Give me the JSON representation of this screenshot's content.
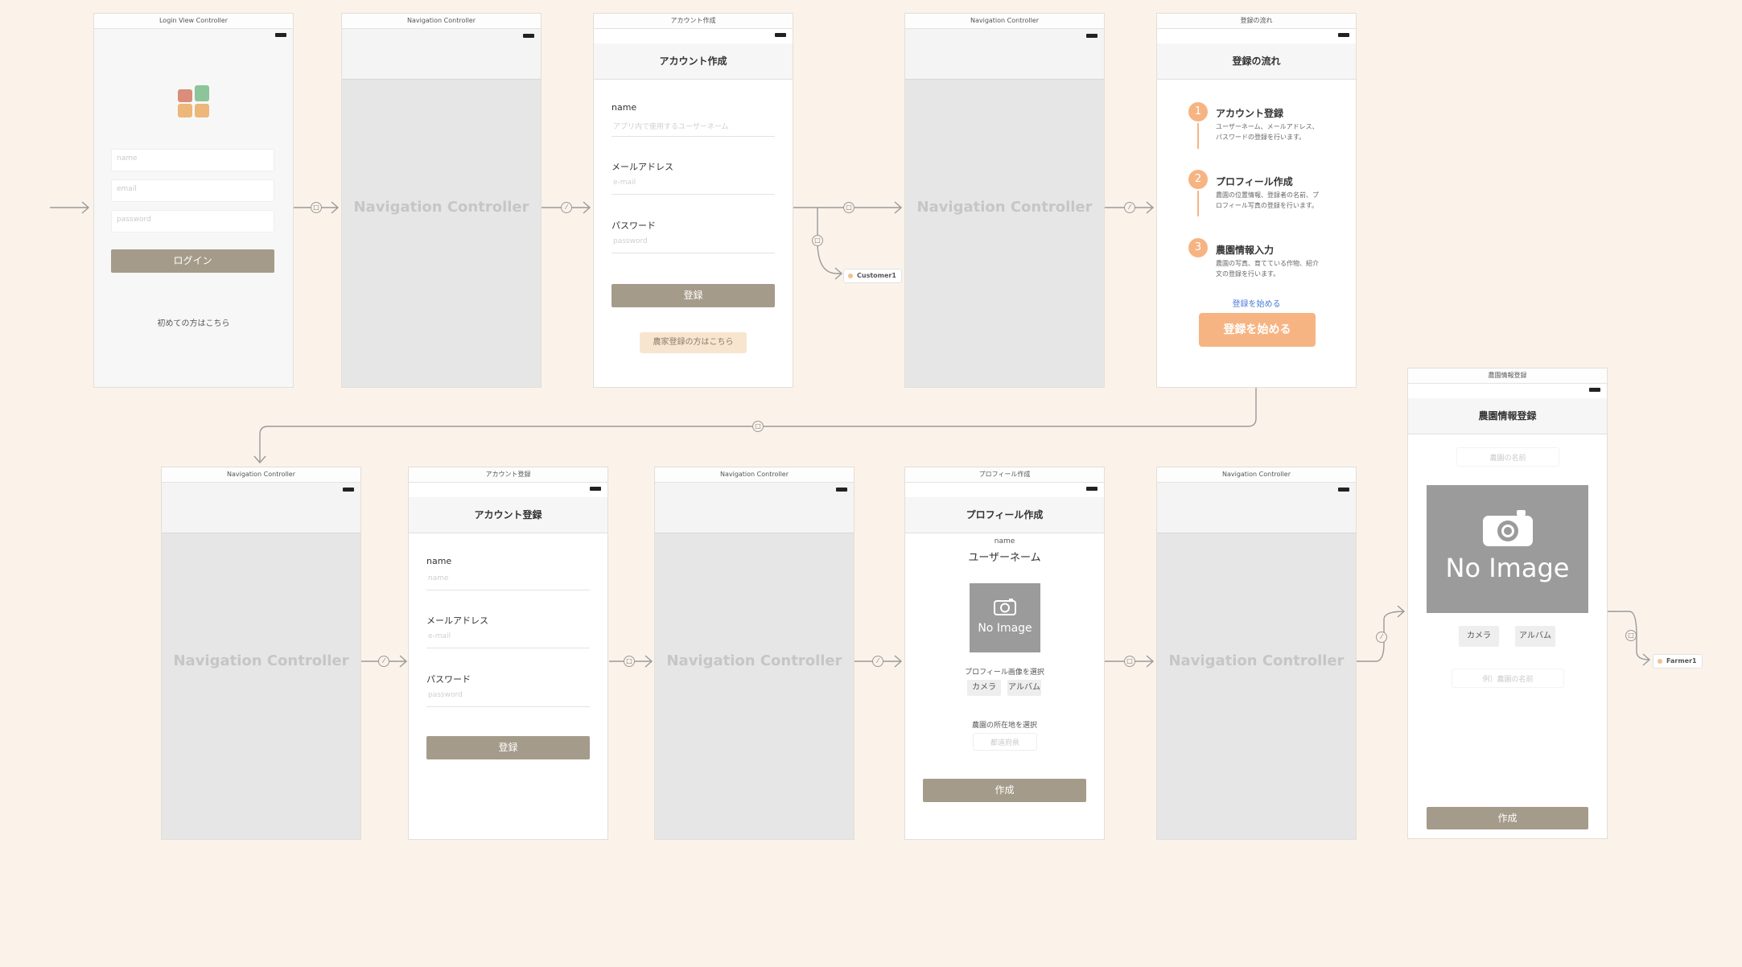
{
  "nav_controller_label": "Navigation Controller",
  "login": {
    "header": "Login View Controller",
    "name_placeholder": "name",
    "email_placeholder": "email",
    "password_placeholder": "password",
    "login_button": "ログイン",
    "first_time_link": "初めての方はこちら"
  },
  "account_create": {
    "header": "アカウント作成",
    "nav_title": "アカウント作成",
    "name_label": "name",
    "name_placeholder": "アプリ内で使用するユーザーネーム",
    "email_label": "メールアドレス",
    "email_placeholder": "e-mail",
    "password_label": "パスワード",
    "password_placeholder": "password",
    "register_button": "登録",
    "farmer_button": "農家登録の方はこちら"
  },
  "flow": {
    "header": "登録の流れ",
    "nav_title": "登録の流れ",
    "steps": [
      {
        "num": "1",
        "title": "アカウント登録",
        "desc1": "ユーザーネーム、メールアドレス、",
        "desc2": "パスワードの登録を行います。"
      },
      {
        "num": "2",
        "title": "プロフィール作成",
        "desc1": "農園の位置情報、登録者の名前、プ",
        "desc2": "ロフィール写真の登録を行います。"
      },
      {
        "num": "3",
        "title": "農園情報入力",
        "desc1": "農園の写真、育てている作物、紹介",
        "desc2": "文の登録を行います。"
      }
    ],
    "link": "登録を始める",
    "start_button": "登録を始める"
  },
  "account_register": {
    "header": "アカウント登録",
    "nav_title": "アカウント登録",
    "name_label": "name",
    "name_placeholder": "name",
    "email_label": "メールアドレス",
    "email_placeholder": "e-mail",
    "password_label": "パスワード",
    "password_placeholder": "password",
    "register_button": "登録"
  },
  "profile": {
    "header": "プロフィール作成",
    "nav_title": "プロフィール作成",
    "name_small": "name",
    "user_name": "ユーザーネーム",
    "no_image": "No Image",
    "select_image": "プロフィール画像を選択",
    "camera": "カメラ",
    "album": "アルバム",
    "location_label": "農園の所在地を選択",
    "location_placeholder": "都道府県",
    "create_button": "作成"
  },
  "farm_info": {
    "header": "農園情報登録",
    "nav_title": "農園情報登録",
    "farm_name_placeholder": "農園の名前",
    "no_image": "No Image",
    "camera": "カメラ",
    "album": "アルバム",
    "crop_placeholder": "例）農園の名前",
    "create_button": "作成"
  },
  "refs": {
    "customer": "Customer1",
    "farmer": "Farmer1"
  }
}
